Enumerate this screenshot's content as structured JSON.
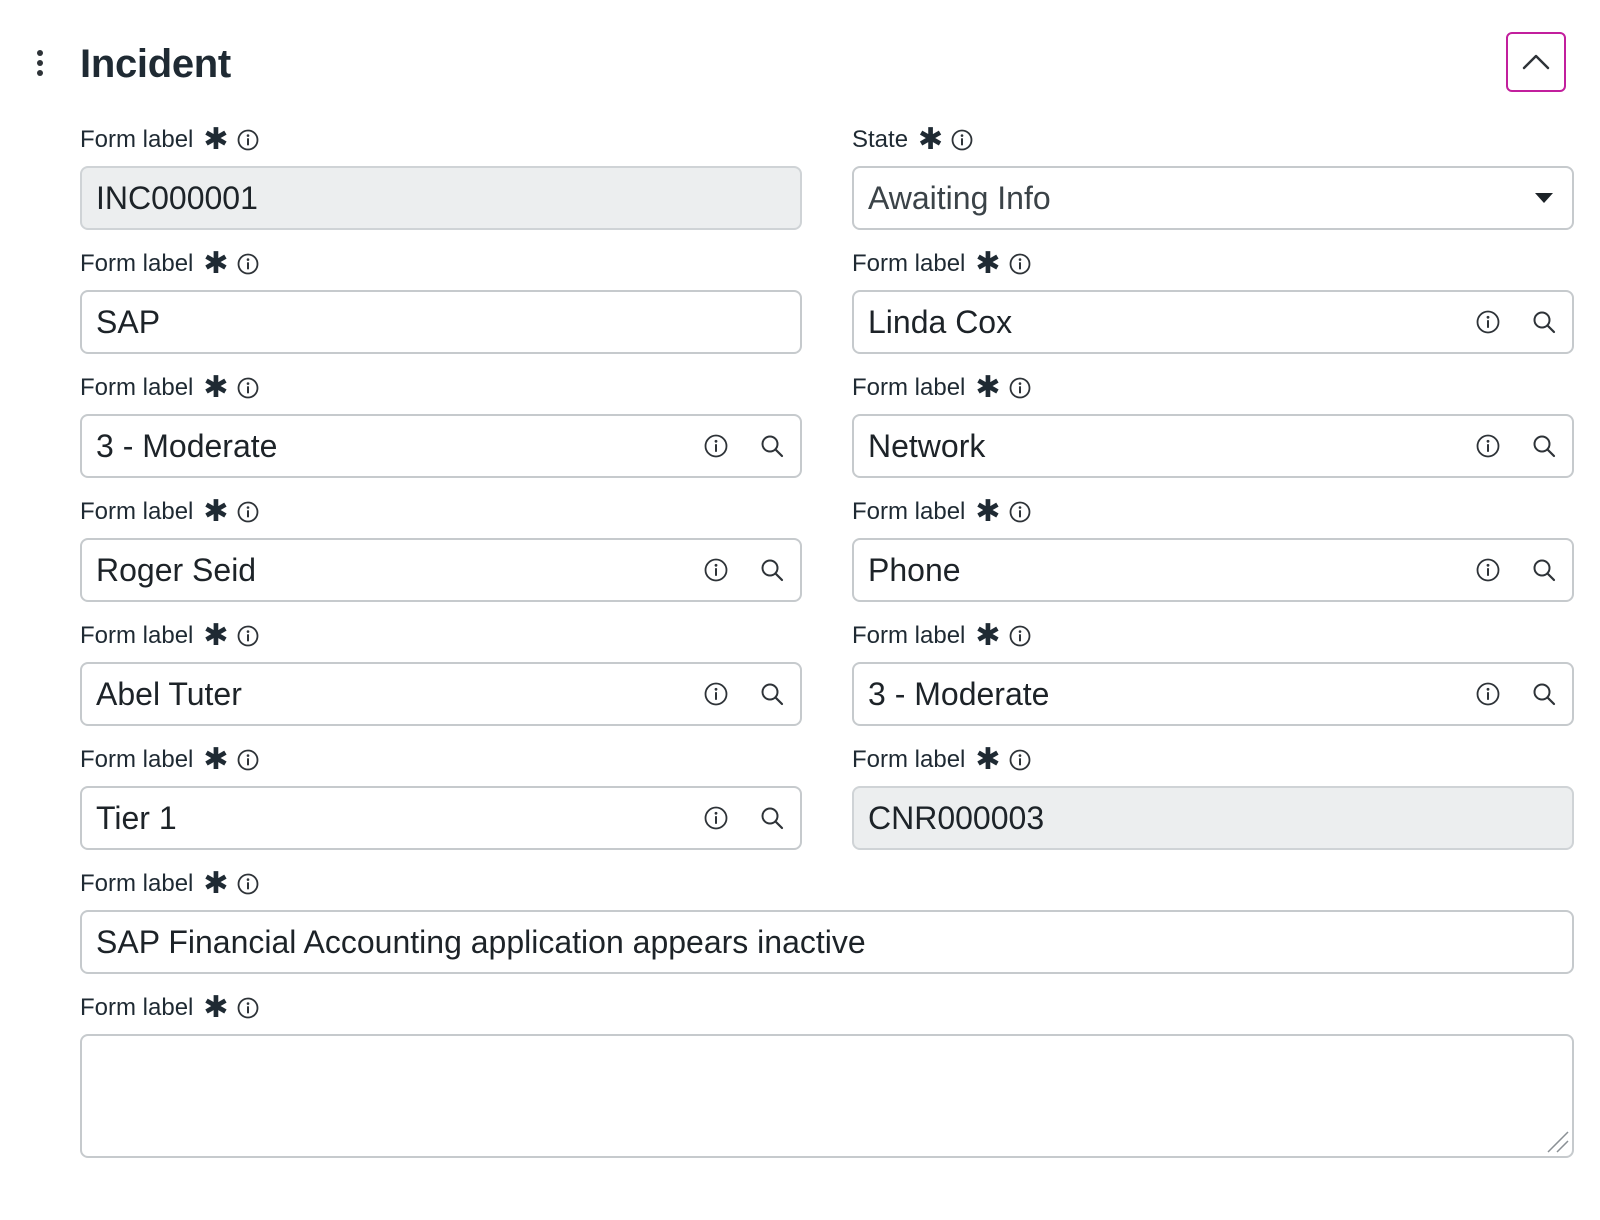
{
  "header": {
    "title": "Incident",
    "menu_icon": "kebab-vertical-icon",
    "collapse_icon": "chevron-up-icon",
    "accent_color": "#c21f9d"
  },
  "fields": {
    "number": {
      "label": "Form label",
      "required_mark": "*",
      "value": "INC000001",
      "readonly": true
    },
    "state": {
      "label": "State",
      "required_mark": "*",
      "value": "Awaiting Info",
      "type": "select"
    },
    "service": {
      "label": "Form label",
      "required_mark": "*",
      "value": "SAP"
    },
    "caller": {
      "label": "Form label",
      "required_mark": "*",
      "value": "Linda Cox",
      "type": "reference"
    },
    "impact": {
      "label": "Form label",
      "required_mark": "*",
      "value": "3 - Moderate",
      "type": "reference"
    },
    "category": {
      "label": "Form label",
      "required_mark": "*",
      "value": "Network",
      "type": "reference"
    },
    "assigned_to": {
      "label": "Form label",
      "required_mark": "*",
      "value": "Roger Seid",
      "type": "reference"
    },
    "channel": {
      "label": "Form label",
      "required_mark": "*",
      "value": "Phone",
      "type": "reference"
    },
    "opened_by": {
      "label": "Form label",
      "required_mark": "*",
      "value": "Abel Tuter",
      "type": "reference"
    },
    "urgency": {
      "label": "Form label",
      "required_mark": "*",
      "value": "3 - Moderate",
      "type": "reference"
    },
    "group": {
      "label": "Form label",
      "required_mark": "*",
      "value": "Tier 1",
      "type": "reference"
    },
    "contract": {
      "label": "Form label",
      "required_mark": "*",
      "value": "CNR000003",
      "readonly": true
    },
    "short_description": {
      "label": "Form label",
      "required_mark": "*",
      "value": "SAP Financial Accounting application appears inactive"
    },
    "description": {
      "label": "Form label",
      "required_mark": "*",
      "value": "",
      "type": "textarea"
    }
  }
}
